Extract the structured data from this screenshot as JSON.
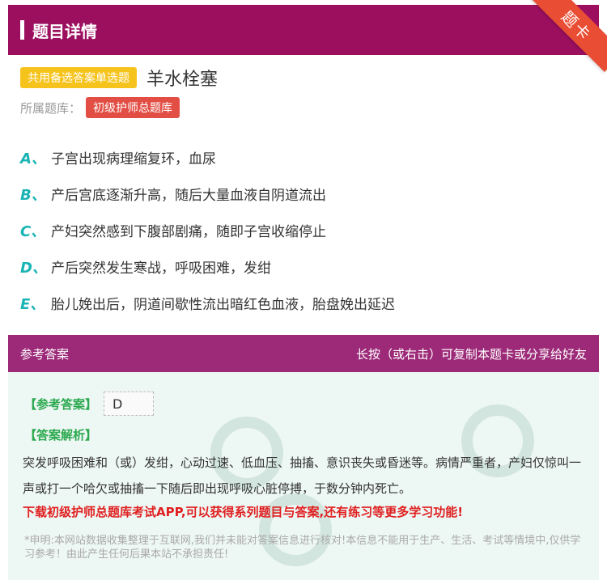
{
  "header": {
    "title": "题目详情",
    "corner_label": "题卡"
  },
  "question": {
    "type_badge": "共用备选答案单选题",
    "title": "羊水栓塞",
    "bank_label": "所属题库：",
    "bank_name": "初级护师总题库"
  },
  "options": [
    {
      "letter": "A、",
      "text": "子宫出现病理缩复环，血尿"
    },
    {
      "letter": "B、",
      "text": "产后宫底逐渐升高，随后大量血液自阴道流出"
    },
    {
      "letter": "C、",
      "text": "产妇突然感到下腹部剧痛，随即子宫收缩停止"
    },
    {
      "letter": "D、",
      "text": "产后突然发生寒战，呼吸困难，发绀"
    },
    {
      "letter": "E、",
      "text": "胎儿娩出后，阴道间歇性流出暗红色血液，胎盘娩出延迟"
    }
  ],
  "answer_section": {
    "title": "参考答案",
    "share_hint": "长按（或右击）可复制本题卡或分享给好友",
    "answer_key_label": "【参考答案】",
    "answer_value": "D",
    "analysis_label": "【答案解析】",
    "analysis_text": "突发呼吸困难和（或）发绀，心动过速、低血压、抽搐、意识丧失或昏迷等。病情严重者，产妇仅惊叫一声或打一个哈欠或抽搐一下随后即出现呼吸心脏停搏，于数分钟内死亡。",
    "download_text": "下载初级护师总题库考试APP,可以获得系列题目与答案,还有练习等更多学习功能!",
    "disclaimer": "*申明:本网站数据收集整理于互联网,我们并未能对答案信息进行核对!本信息不能用于生产、生活、考试等情境中,仅供学习参考！由此产生任何后果本站不承担责任!"
  },
  "colors": {
    "header": "#9c0f5f",
    "option_letter": "#1bb4b4",
    "answer_green": "#2ca94f",
    "download_red": "#e02020"
  }
}
